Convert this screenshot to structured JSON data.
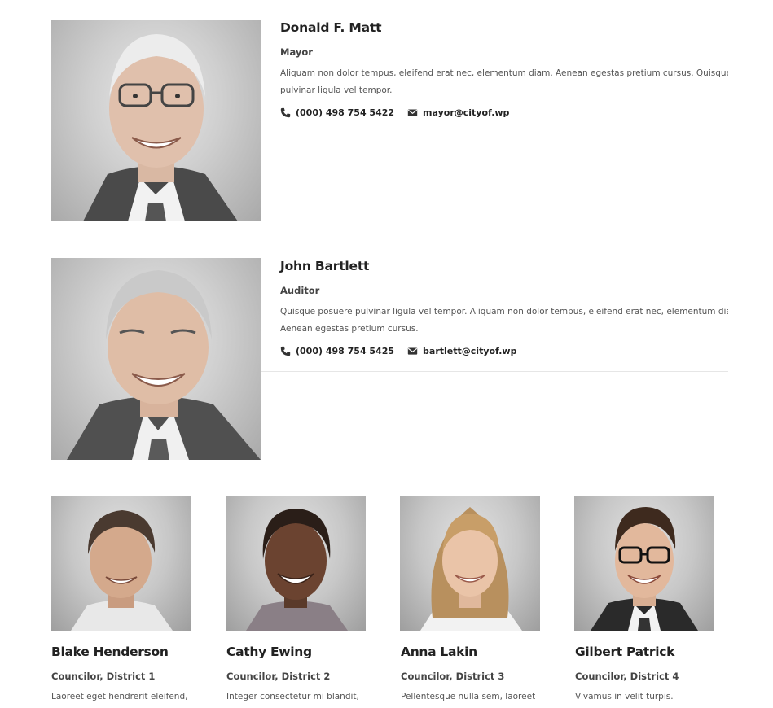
{
  "featured": [
    {
      "name": "Donald F. Matt",
      "role": "Mayor",
      "description_lines": [
        "Aliquam non dolor tempus, eleifend erat nec, elementum diam. Aenean egestas pretium cursus. Quisque posuere",
        "pulvinar ligula vel tempor."
      ],
      "phone": "(000) 498 754 5422",
      "email": "mayor@cityof.wp",
      "phone_icon": "phone-icon",
      "email_icon": "envelope-icon",
      "photo": "portrait-older-man-glasses"
    },
    {
      "name": "John Bartlett",
      "role": "Auditor",
      "description_lines": [
        "Quisque posuere pulvinar ligula vel tempor. Aliquam non dolor tempus, eleifend erat nec, elementum diam.",
        "Aenean egestas pretium cursus."
      ],
      "phone": "(000) 498 754 5425",
      "email": "bartlett@cityof.wp",
      "phone_icon": "phone-icon",
      "email_icon": "envelope-icon",
      "photo": "portrait-older-man-smiling"
    }
  ],
  "councilors": [
    {
      "name": "Blake Henderson",
      "role": "Councilor, District 1",
      "description": "Laoreet eget hendrerit eleifend,",
      "photo": "portrait-young-man"
    },
    {
      "name": "Cathy Ewing",
      "role": "Councilor, District 2",
      "description": "Integer consectetur mi blandit,",
      "photo": "portrait-young-woman-braids"
    },
    {
      "name": "Anna Lakin",
      "role": "Councilor, District 3",
      "description": "Pellentesque nulla sem, laoreet",
      "photo": "portrait-young-woman-blonde"
    },
    {
      "name": "Gilbert Patrick",
      "role": "Councilor, District 4",
      "description": "Vivamus in velit turpis.",
      "photo": "portrait-young-man-glasses"
    }
  ],
  "colors": {
    "heading": "#222222",
    "text": "#555555",
    "divider": "#e6e6e6",
    "photo_bg": "#c7c7c7"
  }
}
